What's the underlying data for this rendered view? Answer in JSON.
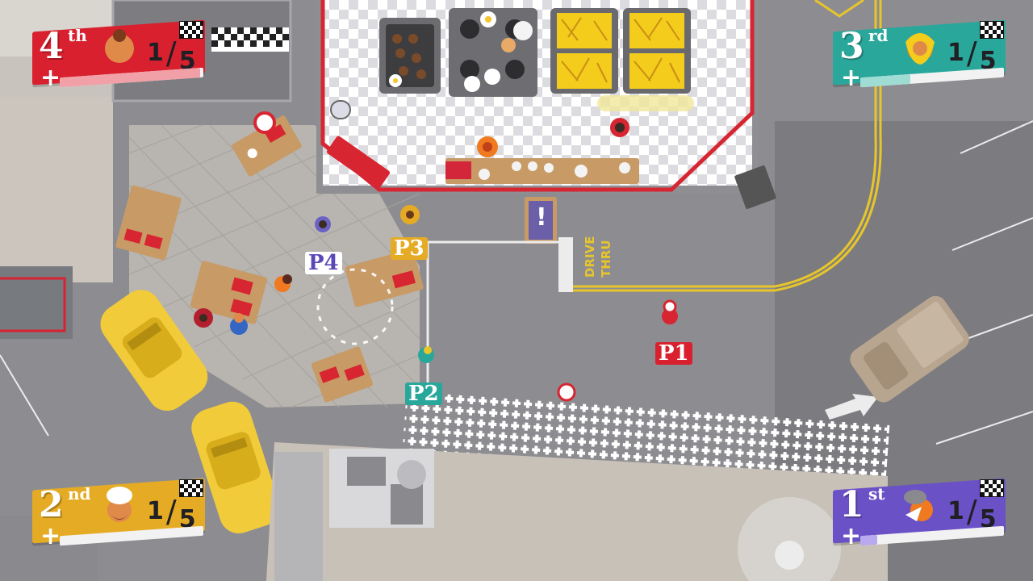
{
  "colors": {
    "red": "#d8202f",
    "teal": "#2aa79b",
    "yellow": "#e6ab24",
    "purple": "#6b51c6",
    "road": "#8f8f93",
    "taxi": "#f2cb3a",
    "wood": "#c89a66"
  },
  "hud": {
    "p_top_left": {
      "rank": "4",
      "suffix": "th",
      "lap_current": "1",
      "lap_total": "5",
      "progress": 0.98,
      "avatar": "bearded-chef-avatar-icon"
    },
    "p_top_right": {
      "rank": "3",
      "suffix": "rd",
      "lap_current": "1",
      "lap_total": "5",
      "progress": 0.35,
      "avatar": "blonde-chef-avatar-icon"
    },
    "p_bottom_left": {
      "rank": "2",
      "suffix": "nd",
      "lap_current": "1",
      "lap_total": "5",
      "progress": 0.0,
      "avatar": "white-hat-chef-avatar-icon"
    },
    "p_bottom_right": {
      "rank": "1",
      "suffix": "st",
      "lap_current": "1",
      "lap_total": "5",
      "progress": 0.12,
      "avatar": "grey-hat-chef-avatar-icon"
    }
  },
  "players": {
    "p1": "P1",
    "p2": "P2",
    "p3": "P3",
    "p4": "P4"
  },
  "map": {
    "drive_thru_line1": "DRIVE",
    "drive_thru_line2": "THRU",
    "alert_sign": "!"
  }
}
